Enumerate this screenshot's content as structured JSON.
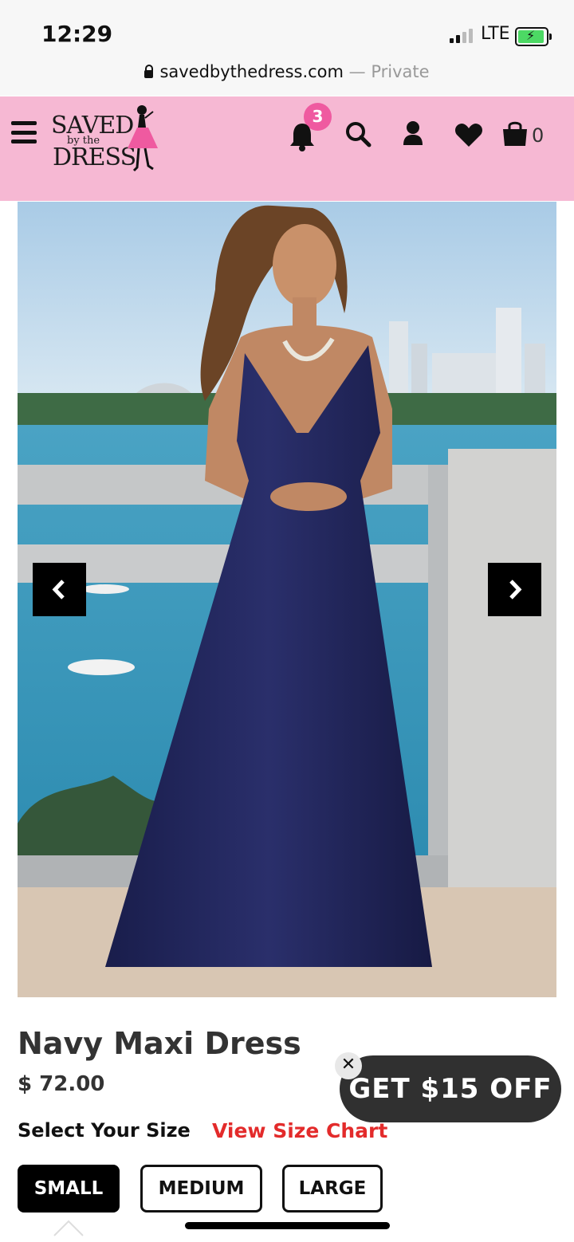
{
  "status_bar": {
    "time": "12:29",
    "network": "LTE"
  },
  "browser": {
    "url": "savedbythedress.com",
    "separator": " — ",
    "mode": "Private"
  },
  "header": {
    "logo": {
      "line1": "SAVED",
      "line2": "by the",
      "line3": "DRESS"
    },
    "notification_count": "3",
    "cart_count": "0",
    "icons": [
      "menu-icon",
      "bell-icon",
      "search-icon",
      "account-icon",
      "heart-icon",
      "cart-icon"
    ],
    "bg_color": "#f6b8d3"
  },
  "product": {
    "name": "Navy Maxi Dress",
    "price": "$ 72.00",
    "select_size_label": "Select Your Size",
    "size_chart_link": "View Size Chart",
    "sizes": [
      {
        "label": "SMALL",
        "selected": true
      },
      {
        "label": "MEDIUM",
        "selected": false
      },
      {
        "label": "LARGE",
        "selected": false
      }
    ]
  },
  "promo": {
    "label": "GET $15 OFF",
    "close": "✕"
  },
  "colors": {
    "accent_pink": "#ef5aa0",
    "link_red": "#e32b2b",
    "dress_navy": "#1f2357"
  }
}
